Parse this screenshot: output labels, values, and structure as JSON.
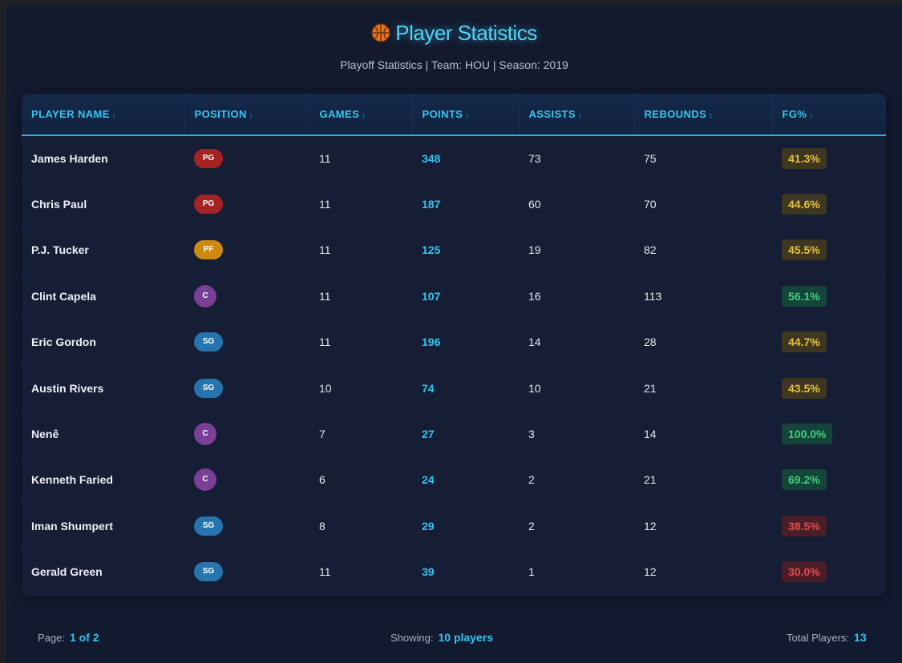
{
  "header": {
    "title": "Player Statistics",
    "icon": "basketball-icon",
    "subtitle": "Playoff Statistics | Team: HOU | Season: 2019"
  },
  "table": {
    "columns": [
      {
        "label": "PLAYER NAME",
        "sort_icon": "↕"
      },
      {
        "label": "POSITION",
        "sort_icon": "↕"
      },
      {
        "label": "GAMES",
        "sort_icon": "↕"
      },
      {
        "label": "POINTS",
        "sort_icon": "↕"
      },
      {
        "label": "ASSISTS",
        "sort_icon": "↕"
      },
      {
        "label": "REBOUNDS",
        "sort_icon": "↕"
      },
      {
        "label": "FG%",
        "sort_icon": "↕"
      }
    ],
    "rows": [
      {
        "name": "James Harden",
        "position": "PG",
        "games": "11",
        "points": "348",
        "assists": "73",
        "rebounds": "75",
        "fg": "41.3%",
        "fg_tier": "yellow"
      },
      {
        "name": "Chris Paul",
        "position": "PG",
        "games": "11",
        "points": "187",
        "assists": "60",
        "rebounds": "70",
        "fg": "44.6%",
        "fg_tier": "yellow"
      },
      {
        "name": "P.J. Tucker",
        "position": "PF",
        "games": "11",
        "points": "125",
        "assists": "19",
        "rebounds": "82",
        "fg": "45.5%",
        "fg_tier": "yellow"
      },
      {
        "name": "Clint Capela",
        "position": "C",
        "games": "11",
        "points": "107",
        "assists": "16",
        "rebounds": "113",
        "fg": "56.1%",
        "fg_tier": "green"
      },
      {
        "name": "Eric Gordon",
        "position": "SG",
        "games": "11",
        "points": "196",
        "assists": "14",
        "rebounds": "28",
        "fg": "44.7%",
        "fg_tier": "yellow"
      },
      {
        "name": "Austin Rivers",
        "position": "SG",
        "games": "10",
        "points": "74",
        "assists": "10",
        "rebounds": "21",
        "fg": "43.5%",
        "fg_tier": "yellow"
      },
      {
        "name": "Nenê",
        "position": "C",
        "games": "7",
        "points": "27",
        "assists": "3",
        "rebounds": "14",
        "fg": "100.0%",
        "fg_tier": "green"
      },
      {
        "name": "Kenneth Faried",
        "position": "C",
        "games": "6",
        "points": "24",
        "assists": "2",
        "rebounds": "21",
        "fg": "69.2%",
        "fg_tier": "green"
      },
      {
        "name": "Iman Shumpert",
        "position": "SG",
        "games": "8",
        "points": "29",
        "assists": "2",
        "rebounds": "12",
        "fg": "38.5%",
        "fg_tier": "red"
      },
      {
        "name": "Gerald Green",
        "position": "SG",
        "games": "11",
        "points": "39",
        "assists": "1",
        "rebounds": "12",
        "fg": "30.0%",
        "fg_tier": "red"
      }
    ]
  },
  "position_colors": {
    "PG": "#a52322",
    "PF": "#cd8a10",
    "C": "#7a3f96",
    "SG": "#2775ae"
  },
  "footer": {
    "page_label": "Page:",
    "page_value": "1 of 2",
    "showing_label": "Showing:",
    "showing_value": "10 players",
    "total_label": "Total Players:",
    "total_value": "13"
  },
  "colors": {
    "accent": "#33c4f0",
    "fg_yellow": "#e8c23d",
    "fg_green": "#3ed07b",
    "fg_red": "#e24b4b"
  }
}
